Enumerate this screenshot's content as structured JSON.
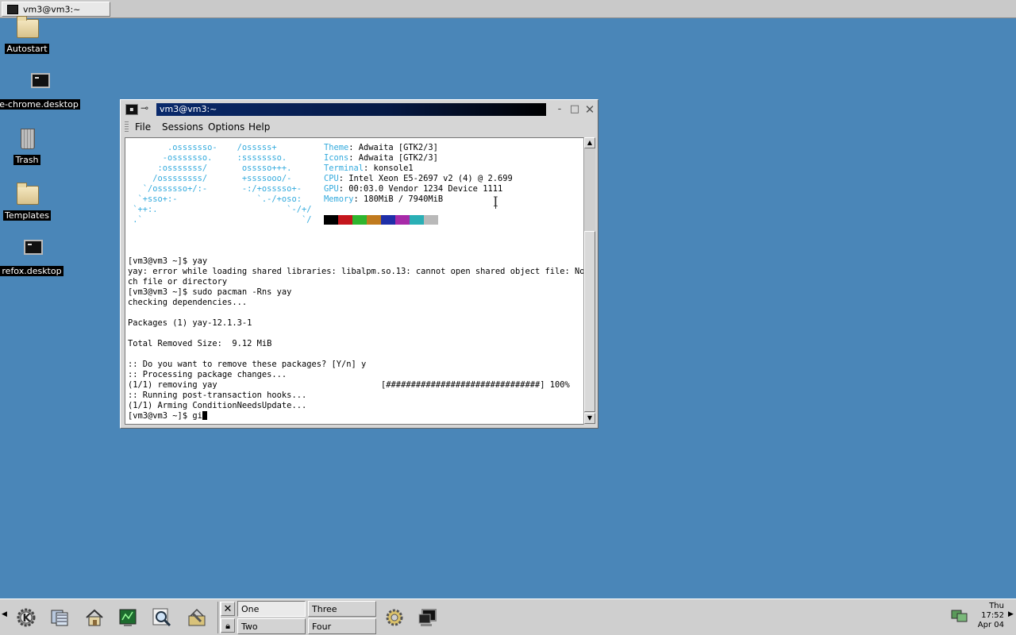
{
  "topbar": {
    "task_title": "vm3@vm3:~"
  },
  "desktop": {
    "icons": [
      {
        "label": "Autostart",
        "icon": "folder-icon"
      },
      {
        "label": "e-chrome.desktop",
        "icon": "terminal-launcher-icon"
      },
      {
        "label": "Trash",
        "icon": "trash-icon"
      },
      {
        "label": "Templates",
        "icon": "folder-icon"
      },
      {
        "label": "refox.desktop",
        "icon": "terminal-launcher-icon"
      }
    ]
  },
  "window": {
    "title": "vm3@vm3:~",
    "menu": [
      "File",
      "Sessions",
      "Options",
      "Help"
    ],
    "art": [
      "        .osssssso-    /osssss+ ",
      "       -osssssso.     :ssssssso. ",
      "      :osssssss/       osssso+++. ",
      "     /ossssssss/       +ssssooo/- ",
      "   `/ossssso+/:-       -:/+osssso+- ",
      "  `+sso+:-                `.-/+oso: ",
      " `++:.                          `-/+/ ",
      " .`                                `/ "
    ],
    "info": [
      {
        "key": "Theme",
        "value": ": Adwaita [GTK2/3]"
      },
      {
        "key": "Icons",
        "value": ": Adwaita [GTK2/3]"
      },
      {
        "key": "Terminal",
        "value": ": konsole1"
      },
      {
        "key": "CPU",
        "value": ": Intel Xeon E5-2697 v2 (4) @ 2.699"
      },
      {
        "key": "GPU",
        "value": ": 00:03.0 Vendor 1234 Device 1111"
      },
      {
        "key": "Memory",
        "value": ": 180MiB / 7940MiB"
      }
    ],
    "palette": [
      "#000000",
      "#c4161c",
      "#2fb52f",
      "#c07a1e",
      "#1f2fa8",
      "#a72aa8",
      "#2aafb5",
      "#b9b9b9"
    ],
    "output": [
      "[vm3@vm3 ~]$ yay",
      "yay: error while loading shared libraries: libalpm.so.13: cannot open shared object file: No su",
      "ch file or directory",
      "[vm3@vm3 ~]$ sudo pacman -Rns yay",
      "checking dependencies...",
      "",
      "Packages (1) yay-12.1.3-1",
      "",
      "Total Removed Size:  9.12 MiB",
      "",
      ":: Do you want to remove these packages? [Y/n] y",
      ":: Processing package changes...",
      "(1/1) removing yay                                 [###############################] 100%",
      ":: Running post-transaction hooks...",
      "(1/1) Arming ConditionNeedsUpdate..."
    ],
    "prompt": "[vm3@vm3 ~]$ gi"
  },
  "panel": {
    "desktops": [
      "One",
      "Two",
      "Three",
      "Four"
    ],
    "active_desktop": "One",
    "clock": {
      "day": "Thu",
      "time": "17:52",
      "date": "Apr 04"
    }
  }
}
